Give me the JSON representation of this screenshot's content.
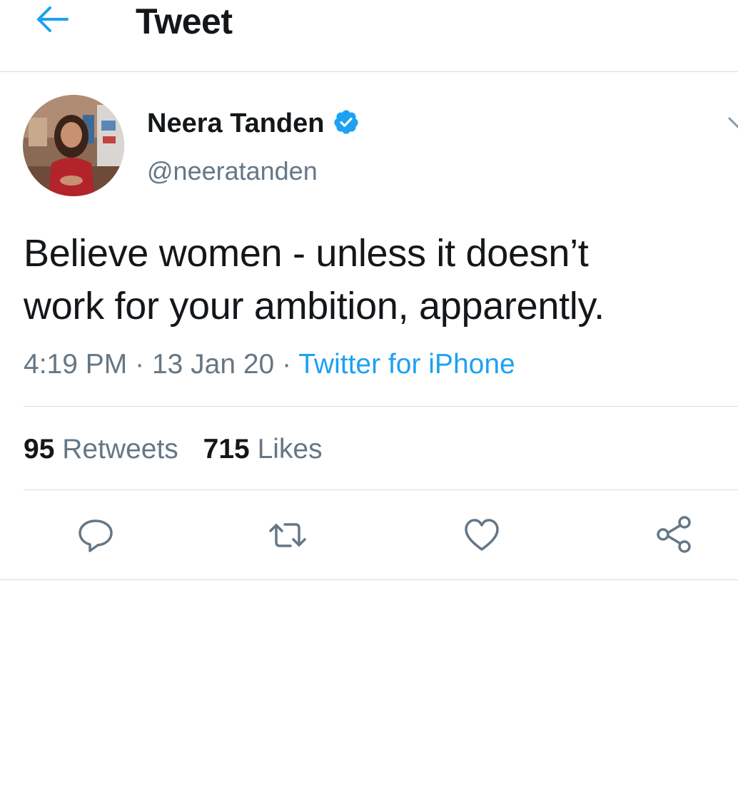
{
  "header": {
    "title": "Tweet",
    "back_icon": "arrow-left-icon"
  },
  "tweet": {
    "author": {
      "name": "Neera Tanden",
      "handle": "@neeratanden",
      "verified": true
    },
    "text_lines": [
      "Believe women - unless it doesn’t",
      "work for your ambition, apparently."
    ],
    "time": "4:19 PM",
    "separator": "·",
    "date": "13 Jan 20",
    "source": "Twitter for iPhone",
    "stats": {
      "retweets_count": "95",
      "retweets_label": "Retweets",
      "likes_count": "715",
      "likes_label": "Likes"
    },
    "actions": [
      "reply-icon",
      "retweet-icon",
      "like-icon",
      "share-icon"
    ]
  },
  "colors": {
    "accent": "#1da1f2",
    "text": "#14171a",
    "secondary_text": "#657786",
    "divider": "#d9dde1",
    "icon": "#657786"
  }
}
